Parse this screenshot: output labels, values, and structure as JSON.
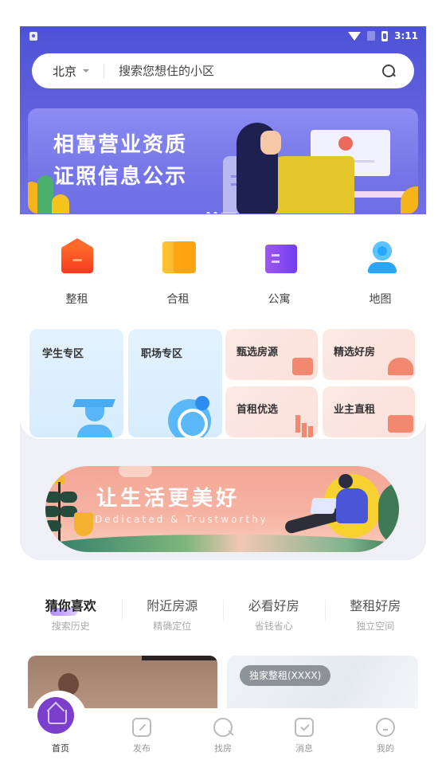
{
  "status_bar": {
    "time": "3:11"
  },
  "search": {
    "city": "北京",
    "placeholder": "搜索您想住的小区"
  },
  "banner_top": {
    "title_line1": "相寓营业资质",
    "title_line2": "证照信息公示",
    "slide_count": 3,
    "active_slide": 3
  },
  "quick_entries": [
    {
      "label": "整租",
      "icon": "house-icon",
      "color": "#f5481f"
    },
    {
      "label": "合租",
      "icon": "door-icon",
      "color": "#ffac1f"
    },
    {
      "label": "公寓",
      "icon": "apartment-icon",
      "color": "#8a4af1"
    },
    {
      "label": "地图",
      "icon": "map-pin-icon",
      "color": "#27a6ff"
    }
  ],
  "zones": {
    "student": {
      "label": "学生专区",
      "icon": "graduate-icon"
    },
    "career": {
      "label": "职场专区",
      "icon": "target-icon"
    },
    "small": [
      {
        "label": "甄选房源",
        "icon": "star-badge-icon"
      },
      {
        "label": "精选好房",
        "icon": "house-roof-icon"
      },
      {
        "label": "首租优选",
        "icon": "bar-chart-icon"
      },
      {
        "label": "业主直租",
        "icon": "handshake-icon"
      }
    ]
  },
  "banner_mid": {
    "title": "让生活更美好",
    "subtitle": "Dedicated & Trustworthy"
  },
  "feed_tabs": [
    {
      "title": "猜你喜欢",
      "subtitle": "搜索历史",
      "active": true
    },
    {
      "title": "附近房源",
      "subtitle": "精确定位",
      "active": false
    },
    {
      "title": "必看好房",
      "subtitle": "省钱省心",
      "active": false
    },
    {
      "title": "整租好房",
      "subtitle": "独立空间",
      "active": false
    }
  ],
  "listings": [
    {
      "tag": ""
    },
    {
      "tag": "独家整租(XXXX)"
    }
  ],
  "bottom_nav": [
    {
      "label": "首页",
      "icon": "home-icon",
      "active": true
    },
    {
      "label": "发布",
      "icon": "edit-icon",
      "active": false
    },
    {
      "label": "找房",
      "icon": "search-icon",
      "active": false
    },
    {
      "label": "消息",
      "icon": "message-icon",
      "active": false
    },
    {
      "label": "我的",
      "icon": "profile-icon",
      "active": false
    }
  ],
  "colors": {
    "header": "#5a5ad8",
    "accent": "#7c3fcb",
    "zone_blue": "#dcefff",
    "zone_pink": "#fce5df",
    "banner_coral": "#f4a794"
  }
}
